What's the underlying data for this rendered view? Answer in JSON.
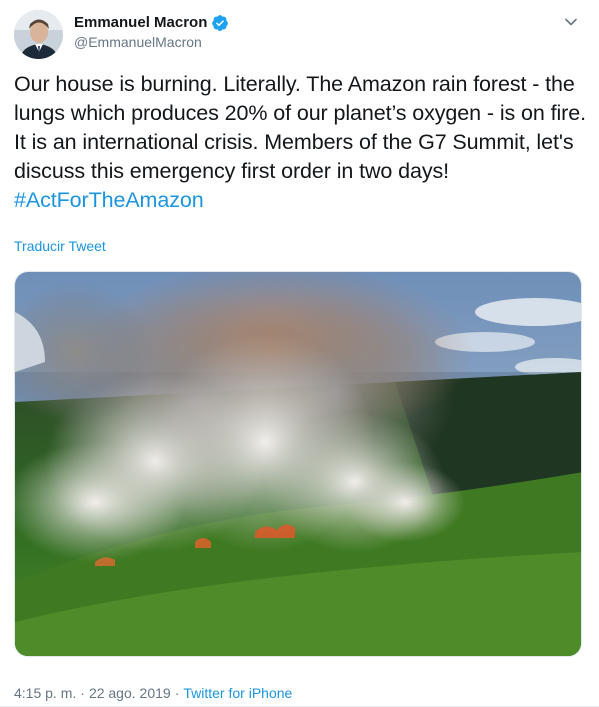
{
  "author": {
    "name": "Emmanuel Macron",
    "handle": "@EmmanuelMacron",
    "verified": true
  },
  "tweet": {
    "text": "Our house is burning. Literally. The Amazon rain forest - the lungs which produces 20% of our planet’s oxygen - is on fire. It is an international crisis. Members of the G7 Summit, let's discuss this emergency first order in two days!",
    "hashtag": "#ActForTheAmazon",
    "translate_label": "Traducir Tweet"
  },
  "media": {
    "description": "aerial-photo-amazon-forest-fire"
  },
  "meta": {
    "time": "4:15 p. m.",
    "separator1": "·",
    "date": "22 ago. 2019",
    "separator2": "·",
    "source": "Twitter for iPhone"
  },
  "colors": {
    "link": "#1b95e0",
    "text": "#14171a",
    "secondary": "#657786",
    "verified": "#1da1f2"
  },
  "icons": {
    "verified": "verified-badge-icon",
    "more": "chevron-down-icon"
  }
}
